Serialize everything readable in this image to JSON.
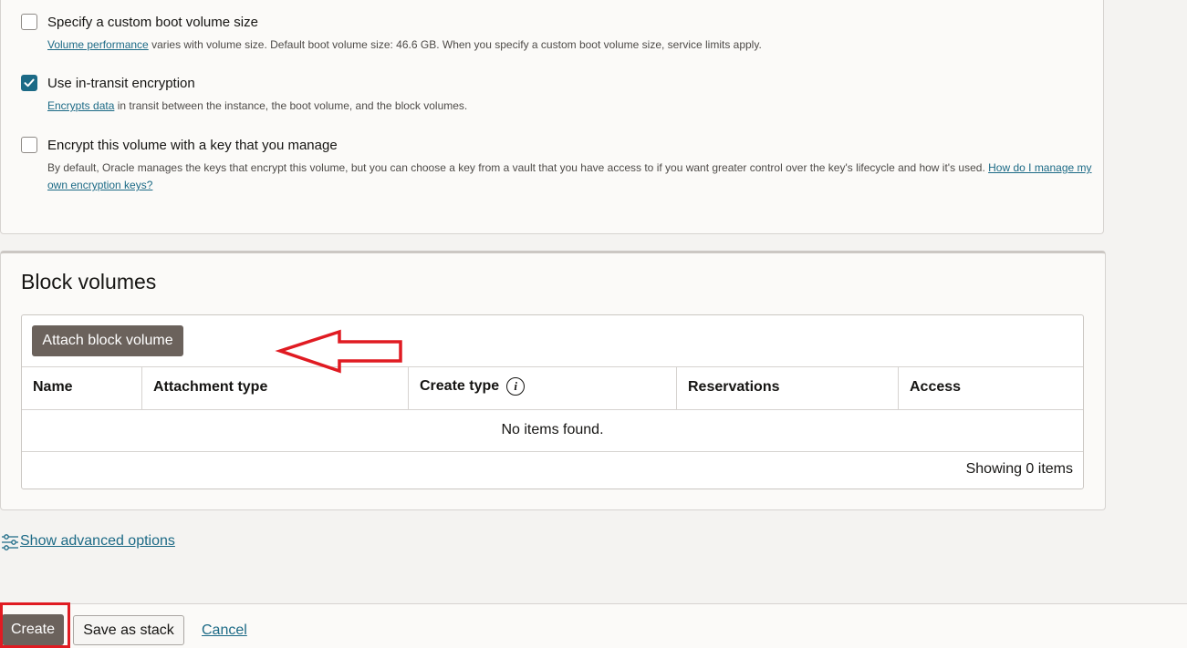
{
  "boot_options": {
    "custom_size": {
      "label": "Specify a custom boot volume size",
      "checked": false,
      "help_link": "Volume performance",
      "help_text": " varies with volume size. Default boot volume size: 46.6 GB. When you specify a custom boot volume size, service limits apply."
    },
    "in_transit": {
      "label": "Use in-transit encryption",
      "checked": true,
      "help_link": "Encrypts data",
      "help_text": " in transit between the instance, the boot volume, and the block volumes."
    },
    "own_key": {
      "label": "Encrypt this volume with a key that you manage",
      "checked": false,
      "help_text": "By default, Oracle manages the keys that encrypt this volume, but you can choose a key from a vault that you have access to if you want greater control over the key's lifecycle and how it's used. ",
      "help_link": "How do I manage my own encryption keys?"
    }
  },
  "block_volumes": {
    "title": "Block volumes",
    "attach_button": "Attach block volume",
    "columns": [
      "Name",
      "Attachment type",
      "Create type",
      "Reservations",
      "Access"
    ],
    "create_type_info_icon": "info-icon",
    "empty_message": "No items found.",
    "footer_count": "Showing 0 items"
  },
  "advanced": {
    "link": "Show advanced options",
    "icon": "sliders-icon"
  },
  "footer": {
    "create": "Create",
    "save_stack": "Save as stack",
    "cancel": "Cancel"
  },
  "annotation": {
    "color": "#e01b22",
    "arrow_icon": "arrow-left-icon"
  },
  "colors": {
    "accent": "#1c6a86",
    "primary_button": "#6b625c",
    "background": "#f4f3f1",
    "panel": "#fbfaf8"
  }
}
